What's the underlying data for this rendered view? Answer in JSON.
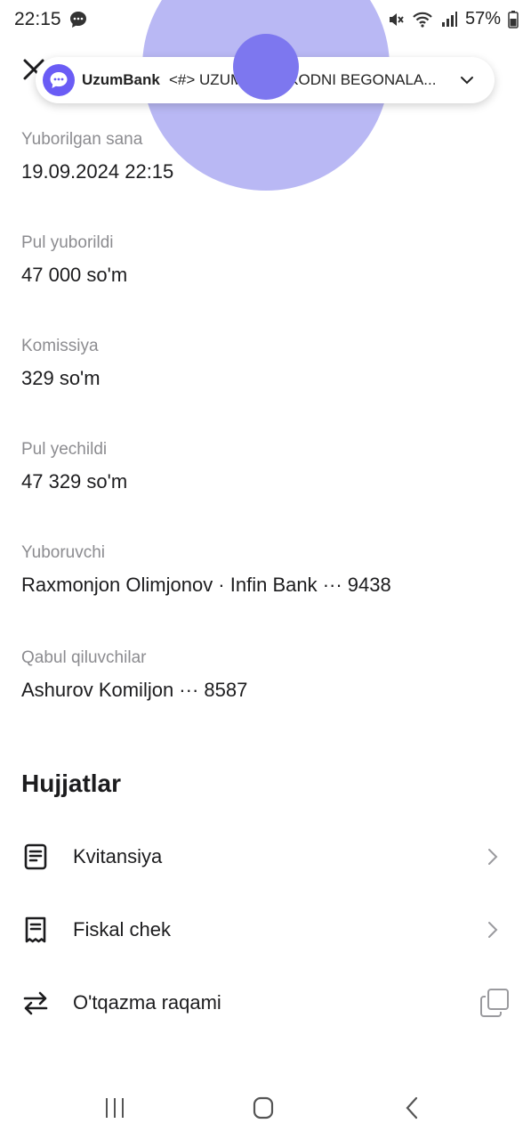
{
  "status": {
    "time": "22:15",
    "battery": "57%"
  },
  "notification": {
    "app": "UzumBank",
    "text": "<#> UZUMBANK KODNI BEGONALA..."
  },
  "fields": [
    {
      "label": "Yuborilgan sana",
      "value": "19.09.2024 22:15"
    },
    {
      "label": "Pul yuborildi",
      "value": "47 000 so'm"
    },
    {
      "label": "Komissiya",
      "value": "329 so'm"
    },
    {
      "label": "Pul yechildi",
      "value": "47 329 so'm"
    },
    {
      "label": "Yuboruvchi",
      "value": "Raxmonjon Olimjonov · Infin Bank ··· 9438"
    },
    {
      "label": "Qabul qiluvchilar",
      "value": "Ashurov Komiljon ··· 8587"
    }
  ],
  "documents": {
    "title": "Hujjatlar",
    "items": [
      {
        "label": "Kvitansiya",
        "icon": "receipt-document-icon"
      },
      {
        "label": "Fiskal chek",
        "icon": "fiscal-receipt-icon"
      },
      {
        "label": "O'tqazma raqami",
        "icon": "transfer-arrows-icon"
      }
    ]
  },
  "colors": {
    "accent": "#6a5cf5",
    "overlay": "#b9b8f4",
    "label": "#8c8c90"
  }
}
